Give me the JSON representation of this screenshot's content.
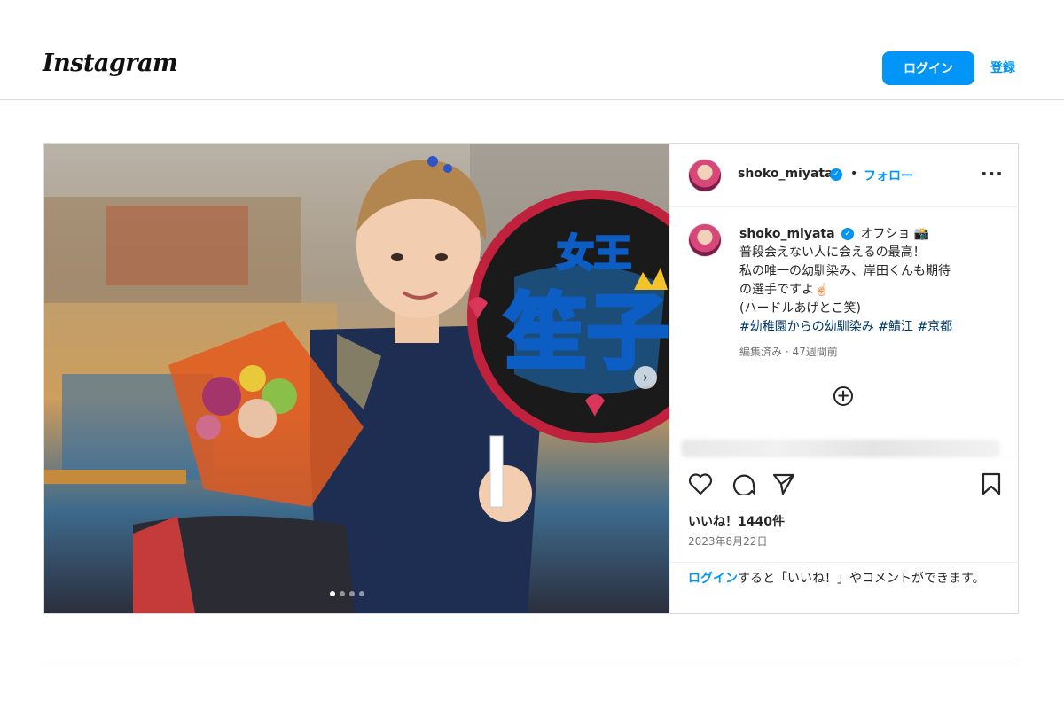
{
  "header": {
    "logo_text": "Instagram",
    "login_label": "ログイン",
    "signup_label": "登録"
  },
  "post": {
    "username": "shoko_miyata",
    "follow_label": "フォロー",
    "separator": "•",
    "caption": {
      "username": "shoko_miyata",
      "first_line": "オフショ 📸",
      "lines": [
        "普段会えない人に会えるの最高！",
        "私の唯一の幼馴染み、岸田くんも期待",
        "の選手ですよ☝🏻",
        "(ハードルあげとこ笑)"
      ],
      "hashtags": "#幼稚園からの幼馴染み #鯖江 #京都"
    },
    "meta": "編集済み · 47週間前",
    "likes": "いいね！1440件",
    "date": "2023年8月22日",
    "login_prompt": {
      "link": "ログイン",
      "text": "すると「いいね！」やコメントができます。"
    },
    "photo": {
      "fan_sign_top": "女王",
      "fan_sign_main": "笙子",
      "carousel_count": 4,
      "carousel_active": 1
    }
  },
  "colors": {
    "accent": "#0095f6",
    "border": "#dbdbdb",
    "muted": "#737373",
    "hashtag": "#00376b"
  },
  "icons": [
    "more-icon",
    "verified-icon",
    "add-comment-icon",
    "heart-icon",
    "comment-icon",
    "share-icon",
    "bookmark-icon",
    "next-arrow-icon"
  ]
}
